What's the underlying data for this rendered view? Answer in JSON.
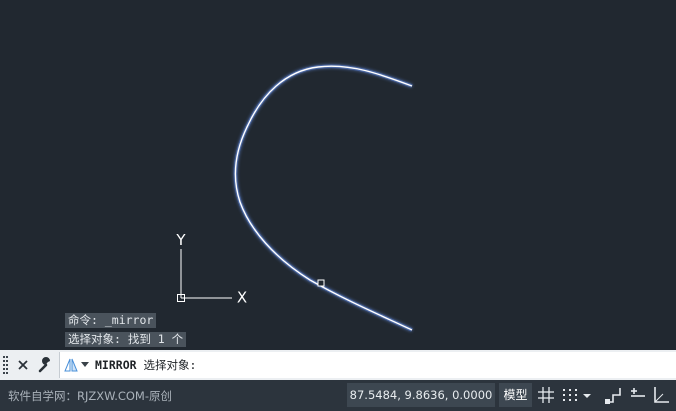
{
  "viewport": {
    "ucs_x_label": "X",
    "ucs_y_label": "Y"
  },
  "history": {
    "line1": "命令: _mirror",
    "line2": "选择对象: 找到 1 个"
  },
  "command_line": {
    "command": "MIRROR",
    "prompt": "选择对象:"
  },
  "status_bar": {
    "watermark": "软件自学网：RJZXW.COM-原创",
    "coordinates": "87.5484, 9.8636, 0.0000",
    "model_label": "模型"
  },
  "colors": {
    "background": "#212830",
    "curve": "#ffffff",
    "curve_glow": "#6e9cff",
    "status_bar": "#2c343d"
  },
  "icons": [
    "grip-handle-icon",
    "close-icon",
    "wrench-icon",
    "mirror-command-icon",
    "chevron-down-icon",
    "grid-icon",
    "snap-icon",
    "ortho-icon",
    "polar-icon",
    "lineweight-icon"
  ]
}
